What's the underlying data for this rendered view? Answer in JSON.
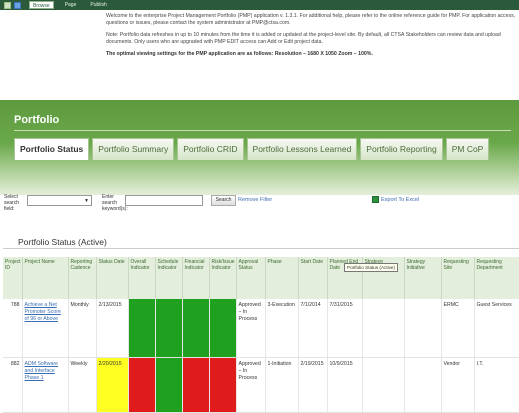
{
  "ribbon": {
    "tabs": [
      "Browse",
      "Page",
      "Publish"
    ]
  },
  "notices": {
    "welcome": "Welcome to the enterprise Project Management Portfolio (PMP) application v. 1.3.1. For additional help, please refer to the online reference guide for PMP. For application access, questions or issues, please contact the system administrator at PMP@ctsa.com.",
    "note": "Note: Portfolio data refreshes in up to 10 minutes from the time it is added or updated at the project-level site. By default, all CTSA Stakeholders can review data and upload documents. Only users who are upgraded with PMP EDIT access can Add or Edit project data.",
    "optimal": "The optimal viewing settings for the PMP application are as follows: Resolution – 1680 X 1050 Zoom – 100%."
  },
  "portfolio": {
    "title": "Portfolio",
    "tabs": [
      {
        "label": "Portfolio Status",
        "active": true
      },
      {
        "label": "Portfolio Summary",
        "active": false
      },
      {
        "label": "Portfolio CRID",
        "active": false
      },
      {
        "label": "Portfolio Lessons Learned",
        "active": false
      },
      {
        "label": "Portfolio Reporting",
        "active": false
      },
      {
        "label": "PM CoP",
        "active": false
      }
    ]
  },
  "filters": {
    "select_label_1": "Select",
    "select_label_2": "search",
    "select_label_3": "field:",
    "enter_label_1": "Enter",
    "enter_label_2": "search",
    "enter_label_3": "keyword(s):",
    "select_value": "",
    "search_value": "",
    "search_button": "Search",
    "remove_filter": "Remove Filter",
    "export": "Export To Excel"
  },
  "status": {
    "title": "Portfolio Status (Active)",
    "columns": [
      "Project ID",
      "Project Name",
      "Reporting Cadence",
      "Status Date",
      "Overall Indicator",
      "Schedule Indicator",
      "Financial Indicator",
      "Risk/Issue Indicator",
      "Approval Status",
      "Phase",
      "Start Date",
      "Planned End Date",
      "Strategy Objective",
      "Strategy Initiative",
      "Requesting Site",
      "Requesting Department"
    ],
    "rows": [
      {
        "id": "788",
        "name": "Achieve a Net Promoter Score of 96 or Above",
        "cadence": "Monthly",
        "status_date": "2/13/2015",
        "overall": "green",
        "schedule": "green",
        "financial": "green",
        "risk": "green",
        "approval": "Approved – In Process",
        "phase": "3-Execution",
        "start": "7/1/2014",
        "end": "7/31/2015",
        "objective": "",
        "initiative": "",
        "site": "ERMC",
        "department": "Guest Services"
      },
      {
        "id": "882",
        "name": "ADM Software and Interface Phase 1",
        "cadence": "Weekly",
        "status_date": "2/20/2015",
        "overall": "red",
        "schedule": "green",
        "financial": "red",
        "risk": "red",
        "approval": "Approved – In Process",
        "phase": "1-Initiation",
        "start": "2/19/2015",
        "end": "10/9/2015",
        "objective": "",
        "initiative": "",
        "site": "Vendor",
        "department": "I.T."
      }
    ],
    "tooltip": "Portfolio Status (Active)"
  },
  "colors": {
    "band": "#69a84a",
    "indicator_green": "#1fa01f",
    "indicator_red": "#e01b1b",
    "status_date_overdue": "#ffff22",
    "link": "#3b6db3"
  }
}
